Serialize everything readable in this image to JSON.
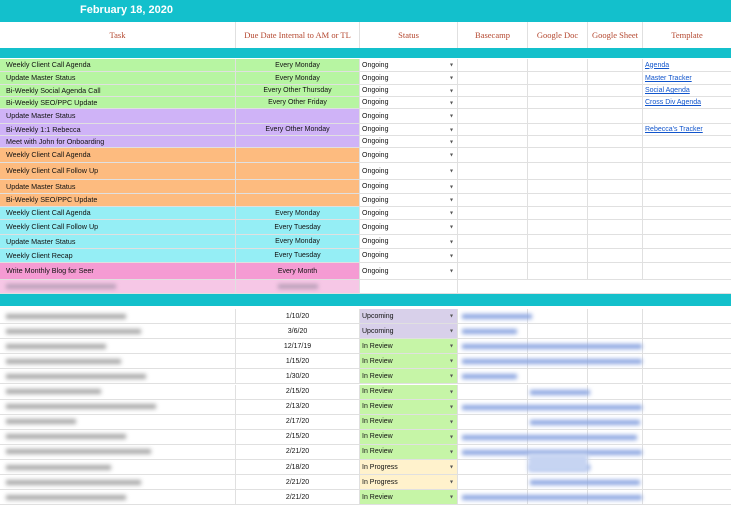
{
  "sheet": {
    "date": "February 18, 2020"
  },
  "columns": {
    "task": "Task",
    "due": "Due Date Internal to AM or TL",
    "status": "Status",
    "basecamp": "Basecamp",
    "gdoc": "Google Doc",
    "gsheet": "Google Sheet",
    "template": "Template"
  },
  "colors": {
    "accent": "#13c0cc",
    "green": "#b7f5a2",
    "purple": "#cfb3f7",
    "orange": "#fdbb7f",
    "cyan": "#95eef5",
    "pink": "#f59bd3",
    "status_green": "#c6f5a7",
    "status_purple": "#d8d0ea",
    "status_yellow": "#fff2cc",
    "header_text": "#b4472f"
  },
  "recurring_tasks": [
    {
      "task": "Weekly Client Call Agenda",
      "due": "Every Monday",
      "status": "Ongoing",
      "template": "Agenda",
      "group": "green"
    },
    {
      "task": "Update Master Status",
      "due": "Every Monday",
      "status": "Ongoing",
      "template": "Master Tracker",
      "group": "green"
    },
    {
      "task": "Bi-Weekly Social Agenda Call",
      "due": "Every Other Thursday",
      "status": "Ongoing",
      "template": "Social Agenda",
      "group": "green"
    },
    {
      "task": "Bi-Weekly SEO/PPC Update",
      "due": "Every Other Friday",
      "status": "Ongoing",
      "template": "Cross Div Agenda",
      "group": "green"
    },
    {
      "task": "Update Master Status",
      "due": "",
      "status": "Ongoing",
      "template": "",
      "group": "purple"
    },
    {
      "task": "Bi-Weekly 1:1 Rebecca",
      "due": "Every Other Monday",
      "status": "Ongoing",
      "template": "Rebecca's Tracker",
      "group": "purple"
    },
    {
      "task": "Meet with John for Onboarding",
      "due": "",
      "status": "Ongoing",
      "template": "",
      "group": "purple"
    },
    {
      "task": "Weekly Client Call Agenda",
      "due": "",
      "status": "Ongoing",
      "template": "",
      "group": "orange"
    },
    {
      "task": "Weekly Client Call Follow Up",
      "due": "",
      "status": "Ongoing",
      "template": "",
      "group": "orange"
    },
    {
      "task": "Update Master Status",
      "due": "",
      "status": "Ongoing",
      "template": "",
      "group": "orange"
    },
    {
      "task": "Bi-Weekly SEO/PPC Update",
      "due": "",
      "status": "Ongoing",
      "template": "",
      "group": "orange"
    },
    {
      "task": "Weekly Client Call Agenda",
      "due": "Every Monday",
      "status": "Ongoing",
      "template": "",
      "group": "cyan"
    },
    {
      "task": "Weekly Client Call Follow Up",
      "due": "Every Tuesday",
      "status": "Ongoing",
      "template": "",
      "group": "cyan"
    },
    {
      "task": "Update Master Status",
      "due": "Every Monday",
      "status": "Ongoing",
      "template": "",
      "group": "cyan"
    },
    {
      "task": "Weekly Client Recap",
      "due": "Every Tuesday",
      "status": "Ongoing",
      "template": "",
      "group": "cyan"
    },
    {
      "task": "Write Monthly Blog for Seer",
      "due": "Every Month",
      "status": "Ongoing",
      "template": "",
      "group": "pink"
    }
  ],
  "dated_tasks": [
    {
      "due": "1/10/20",
      "status": "Upcoming",
      "color": "purple"
    },
    {
      "due": "3/6/20",
      "status": "Upcoming",
      "color": "purple"
    },
    {
      "due": "12/17/19",
      "status": "In Review",
      "color": "green"
    },
    {
      "due": "1/15/20",
      "status": "In Review",
      "color": "green"
    },
    {
      "due": "1/30/20",
      "status": "In Review",
      "color": "green"
    },
    {
      "due": "2/15/20",
      "status": "In Review",
      "color": "green"
    },
    {
      "due": "2/13/20",
      "status": "In Review",
      "color": "green"
    },
    {
      "due": "2/17/20",
      "status": "In Review",
      "color": "green"
    },
    {
      "due": "2/15/20",
      "status": "In Review",
      "color": "green"
    },
    {
      "due": "2/21/20",
      "status": "In Review",
      "color": "green"
    },
    {
      "due": "2/18/20",
      "status": "In Progress",
      "color": "yellow"
    },
    {
      "due": "2/21/20",
      "status": "In Progress",
      "color": "yellow"
    },
    {
      "due": "2/21/20",
      "status": "In Review",
      "color": "green"
    }
  ]
}
